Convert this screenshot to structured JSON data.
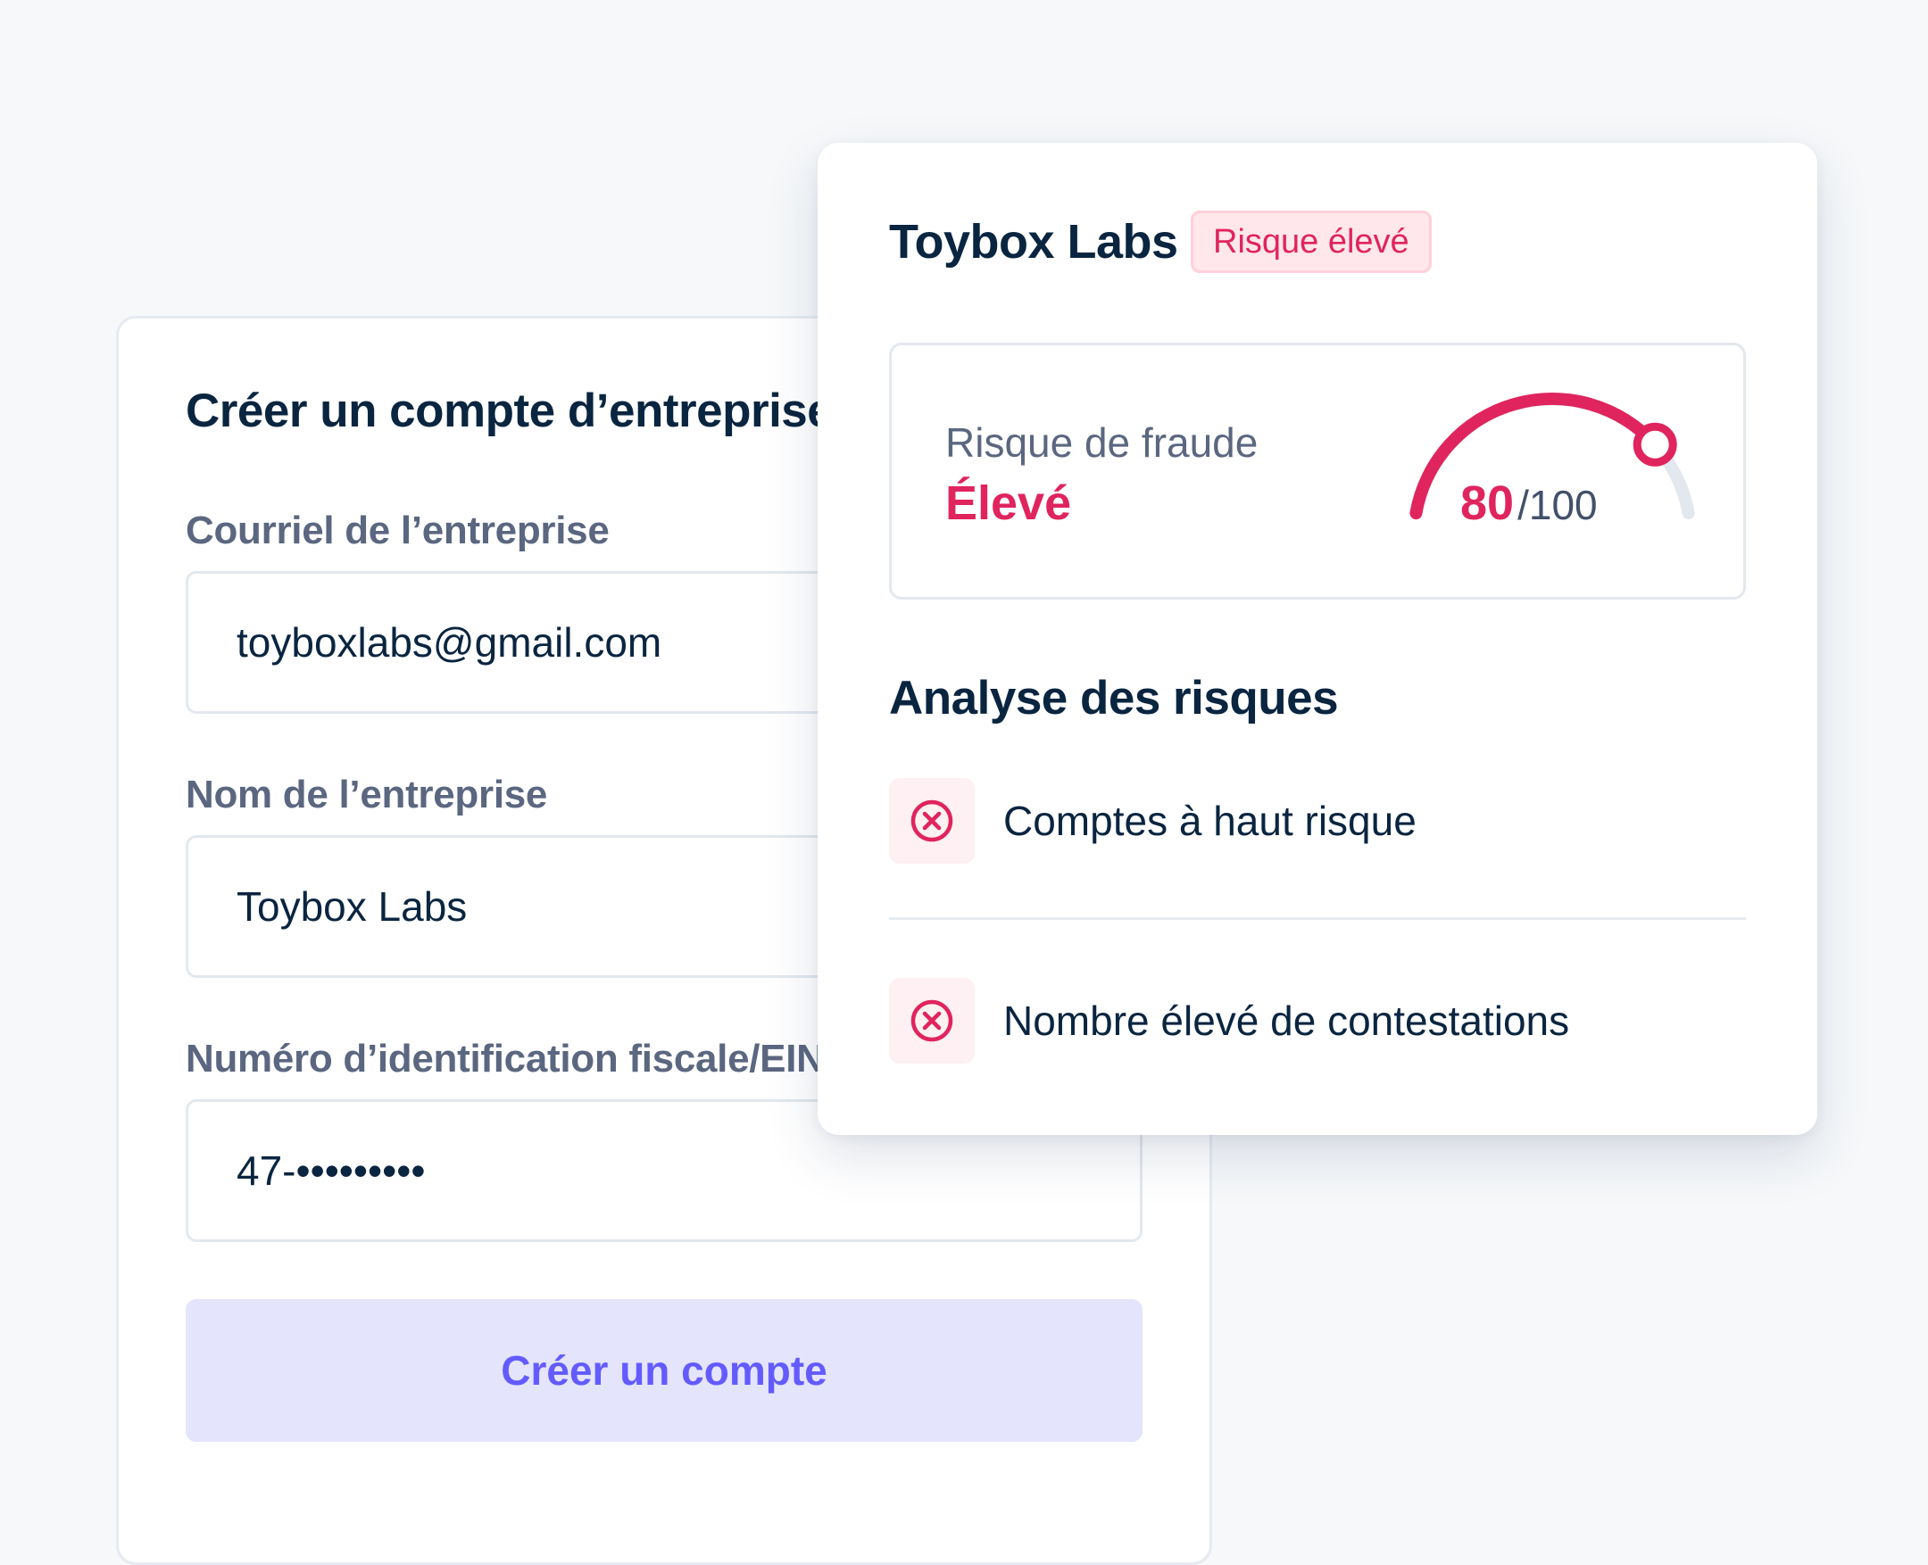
{
  "account_form": {
    "title": "Créer un compte d’entreprise",
    "fields": [
      {
        "label": "Courriel de l’entreprise",
        "value": "toyboxlabs@gmail.com"
      },
      {
        "label": "Nom de l’entreprise",
        "value": "Toybox Labs"
      },
      {
        "label": "Numéro d’identification fiscale/EIN",
        "value": "47-•••••••••"
      }
    ],
    "submit_label": "Créer un compte"
  },
  "risk_panel": {
    "company_name": "Toybox Labs",
    "badge": "Risque élevé",
    "fraud_risk": {
      "label": "Risque de fraude",
      "level": "Élevé",
      "score": "80",
      "max": "/100",
      "score_value": 80,
      "score_max": 100
    },
    "analysis_title": "Analyse des risques",
    "signals": [
      {
        "label": "Comptes à haut risque",
        "icon": "x-circle-icon"
      },
      {
        "label": "Nombre élevé de contestations",
        "icon": "x-circle-icon"
      }
    ]
  },
  "colors": {
    "page_background": "#f6f8fa",
    "danger": "#e0245e",
    "danger_soft": "#ffe7ec",
    "primary": "#635bff",
    "primary_soft": "#e4e4fc",
    "heading": "#0a2540",
    "muted": "#5b6780",
    "gauge_track": "#e3e8ee"
  }
}
